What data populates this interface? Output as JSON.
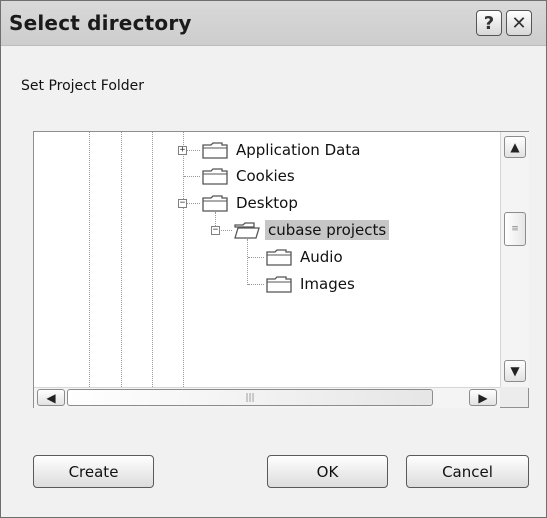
{
  "dialog": {
    "title": "Select directory",
    "help_label": "?",
    "close_label": "✕",
    "subtitle": "Set Project Folder"
  },
  "tree": {
    "nodes": [
      {
        "label": "Application Data",
        "expander": "+"
      },
      {
        "label": "Cookies"
      },
      {
        "label": "Desktop",
        "expander": "−"
      },
      {
        "label": "cubase projects",
        "expander": "−",
        "selected": true
      },
      {
        "label": "Audio"
      },
      {
        "label": "Images"
      }
    ]
  },
  "scrollbars": {
    "up_arrow": "▲",
    "down_arrow": "▼",
    "left_arrow": "◀",
    "right_arrow": "▶",
    "vthumb_grip": "≡",
    "hthumb_grip": "|||"
  },
  "buttons": {
    "create": "Create",
    "ok": "OK",
    "cancel": "Cancel"
  }
}
